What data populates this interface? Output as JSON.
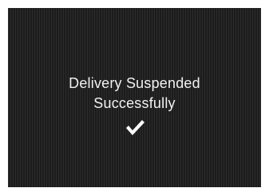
{
  "dialog": {
    "message_line1": "Delivery Suspended",
    "message_line2": "Successfully",
    "icon": "checkmark-icon",
    "colors": {
      "background": "#232323",
      "text": "#f2f2f2",
      "icon": "#ffffff"
    }
  }
}
